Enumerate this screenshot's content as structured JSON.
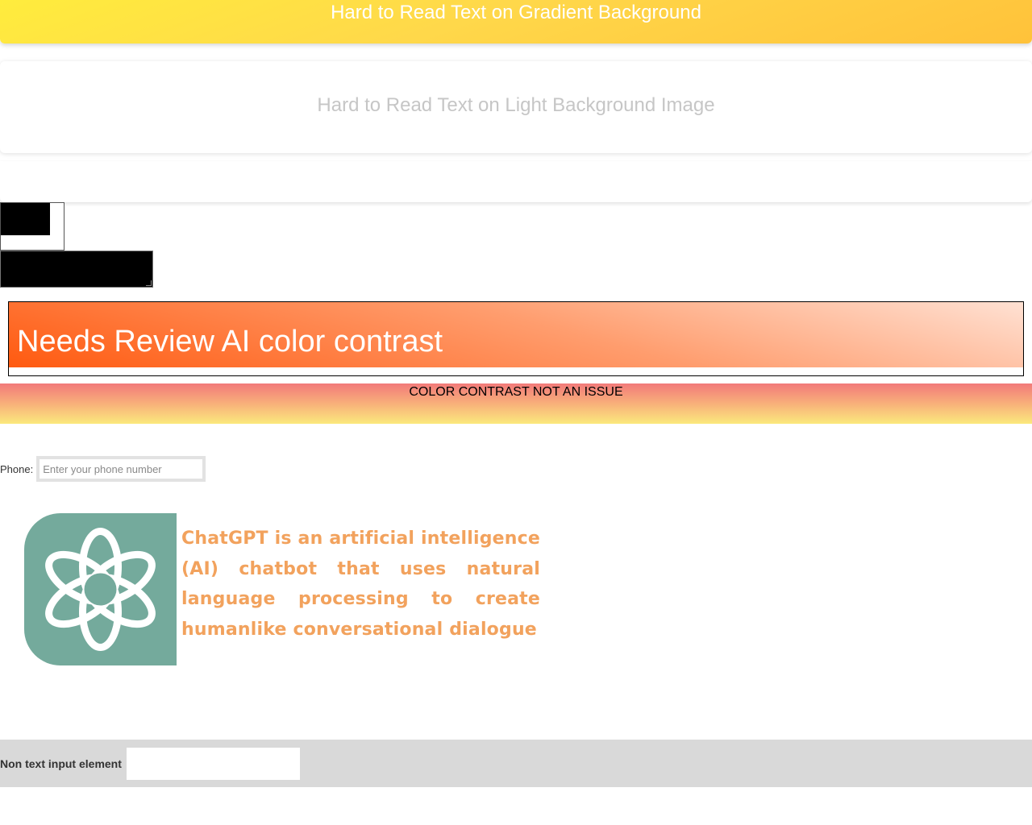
{
  "banner_gradient": {
    "text": "Hard to Read Text on Gradient Background"
  },
  "card_light": {
    "text": "Hard to Read Text on Light Background Image"
  },
  "review": {
    "text": "Needs Review AI color contrast"
  },
  "contrast_band": {
    "text": "COLOR CONTRAST NOT AN ISSUE"
  },
  "phone": {
    "label": "Phone:",
    "placeholder": "Enter your phone number"
  },
  "chatgpt": {
    "text": "ChatGPT is an artificial intelligence (AI) chatbot that uses natural language processing to create humanlike conversational dialogue",
    "logo_icon": "openai-logo-icon",
    "logo_color": "#74aa9c"
  },
  "non_text": {
    "label": "Non text input element"
  },
  "colors": {
    "gradient_yellow": "#ffec3d",
    "orange_start": "#ff5a10",
    "text_orange": "#f2a25d"
  }
}
